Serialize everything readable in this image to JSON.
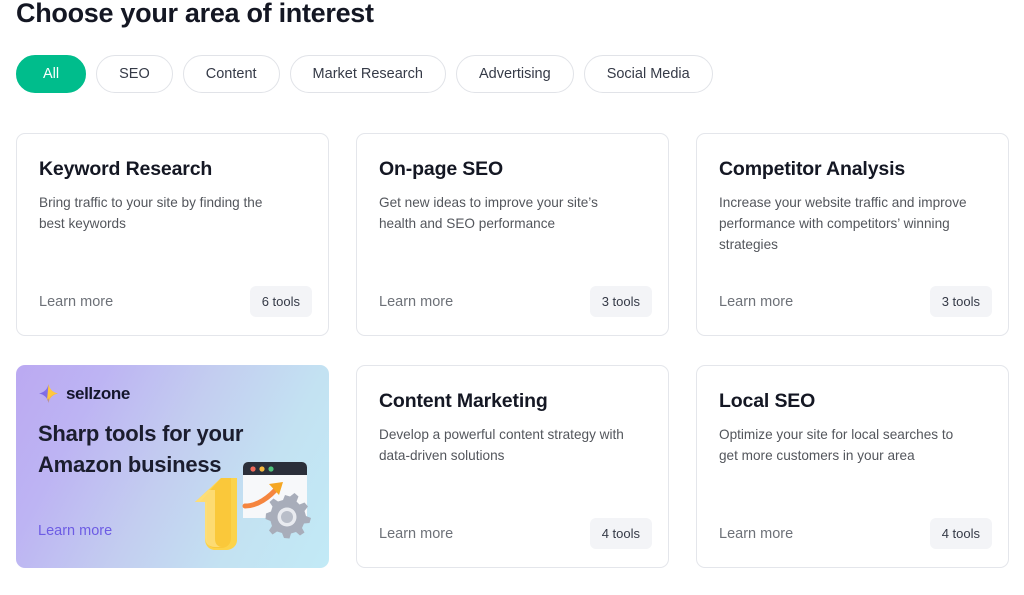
{
  "page": {
    "title": "Choose your area of interest"
  },
  "filters": {
    "items": [
      {
        "label": "All",
        "active": true
      },
      {
        "label": "SEO",
        "active": false
      },
      {
        "label": "Content",
        "active": false
      },
      {
        "label": "Market Research",
        "active": false
      },
      {
        "label": "Advertising",
        "active": false
      },
      {
        "label": "Social Media",
        "active": false
      }
    ]
  },
  "cards": [
    {
      "title": "Keyword Research",
      "description": "Bring traffic to your site by finding the best keywords",
      "learn_more": "Learn more",
      "tools": "6 tools"
    },
    {
      "title": "On-page SEO",
      "description": "Get new ideas to improve your site’s health and SEO performance",
      "learn_more": "Learn more",
      "tools": "3 tools"
    },
    {
      "title": "Competitor Analysis",
      "description": "Increase your website traffic and improve performance with competitors’ winning strategies",
      "learn_more": "Learn more",
      "tools": "3 tools"
    },
    {
      "title": "Content Marketing",
      "description": "Develop a powerful content strategy with data-driven solutions",
      "learn_more": "Learn more",
      "tools": "4 tools"
    },
    {
      "title": "Local SEO",
      "description": "Optimize your site for local searches to get more customers in your area",
      "learn_more": "Learn more",
      "tools": "4 tools"
    }
  ],
  "promo": {
    "brand": "sellzone",
    "headline": "Sharp tools for your Amazon business",
    "learn_more": "Learn more"
  },
  "colors": {
    "accent_green": "#00bd8c",
    "title_dark": "#141723",
    "body_gray": "#53565c",
    "muted_gray": "#6d7178",
    "badge_bg": "#f3f4f7",
    "card_border": "#e4e6eb",
    "promo_link": "#6d5ce4",
    "promo_gradient_start": "#bba9f2",
    "promo_gradient_end": "#c2eaf6"
  }
}
